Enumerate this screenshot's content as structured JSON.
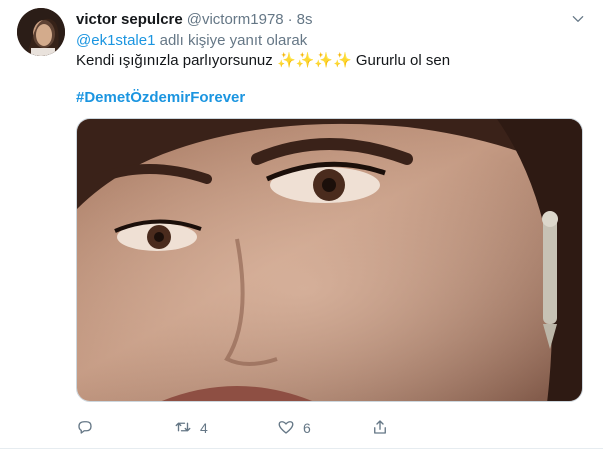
{
  "tweet": {
    "display_name": "victor sepulcre",
    "handle": "@victorm1978",
    "separator": "·",
    "time": "8s",
    "reply_mention": "@ek1stale1",
    "reply_suffix": " adlı kişiye yanıt olarak",
    "text_before": "Kendi ışığınızla parlıyorsunuz ",
    "sparkles": "✨✨✨✨",
    "text_after": " Gururlu ol sen",
    "hashtag": "#DemetÖzdemirForever"
  },
  "actions": {
    "reply_count": "",
    "retweet_count": "4",
    "like_count": "6"
  },
  "icons": {
    "avatar": "avatar",
    "caret": "chevron-down-icon",
    "reply": "reply-icon",
    "retweet": "retweet-icon",
    "like": "heart-icon",
    "share": "share-icon"
  },
  "colors": {
    "link": "#1b95e0",
    "muted": "#657786",
    "text": "#14171a",
    "border": "#e6ecf0"
  }
}
